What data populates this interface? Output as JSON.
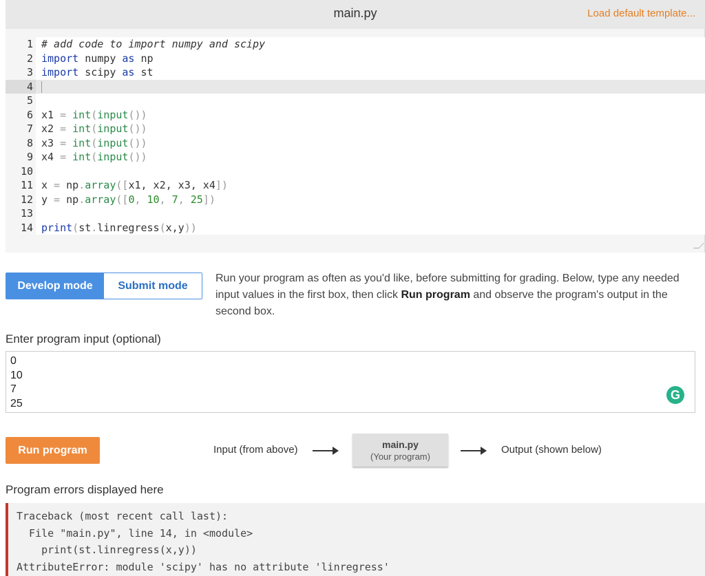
{
  "editor": {
    "filename": "main.py",
    "load_template_label": "Load default template...",
    "lines": [
      {
        "num": "1"
      },
      {
        "num": "2"
      },
      {
        "num": "3"
      },
      {
        "num": "4"
      },
      {
        "num": "5"
      },
      {
        "num": "6"
      },
      {
        "num": "7"
      },
      {
        "num": "8"
      },
      {
        "num": "9"
      },
      {
        "num": "10"
      },
      {
        "num": "11"
      },
      {
        "num": "12"
      },
      {
        "num": "13"
      },
      {
        "num": "14"
      }
    ],
    "code": {
      "l1": "# add code to import numpy and scipy",
      "l2_kw": "import",
      "l2_mod": " numpy ",
      "l2_as": "as",
      "l2_alias": " np",
      "l3_kw": "import",
      "l3_mod": " scipy ",
      "l3_as": "as",
      "l3_alias": " st",
      "l6_var": "x1",
      "l7_var": "x2",
      "l8_var": "x3",
      "l9_var": "x4",
      "assign": " = ",
      "int_call": "int",
      "input_call": "input",
      "l11_var": "x",
      "l11_np": "np",
      "l11_fn": "array",
      "l11_args": "x1, x2, x3, x4",
      "l12_var": "y",
      "l12_np": "np",
      "l12_fn": "array",
      "l12_n1": "0",
      "l12_n2": "10",
      "l12_n3": "7",
      "l12_n4": "25",
      "l14_fn": "print",
      "l14_mod": "st",
      "l14_method": "linregress",
      "l14_args": "x,y"
    }
  },
  "modes": {
    "develop_label": "Develop mode",
    "submit_label": "Submit mode"
  },
  "instructions": {
    "part1": "Run your program as often as you'd like, before submitting for grading. Below, type any needed input values in the first box, then click ",
    "bold": "Run program",
    "part2": " and observe the program's output in the second box."
  },
  "input_section": {
    "label": "Enter program input (optional)",
    "values": [
      "0",
      "10",
      "7",
      "25"
    ]
  },
  "run": {
    "button_label": "Run program",
    "flow_input": "Input (from above)",
    "program_name": "main.py",
    "program_sub": "(Your program)",
    "flow_output": "Output (shown below)"
  },
  "errors": {
    "label": "Program errors displayed here",
    "lines": [
      "Traceback (most recent call last):",
      "  File \"main.py\", line 14, in <module>",
      "    print(st.linregress(x,y))",
      "AttributeError: module 'scipy' has no attribute 'linregress'"
    ]
  },
  "icons": {
    "grammarly": "G"
  }
}
